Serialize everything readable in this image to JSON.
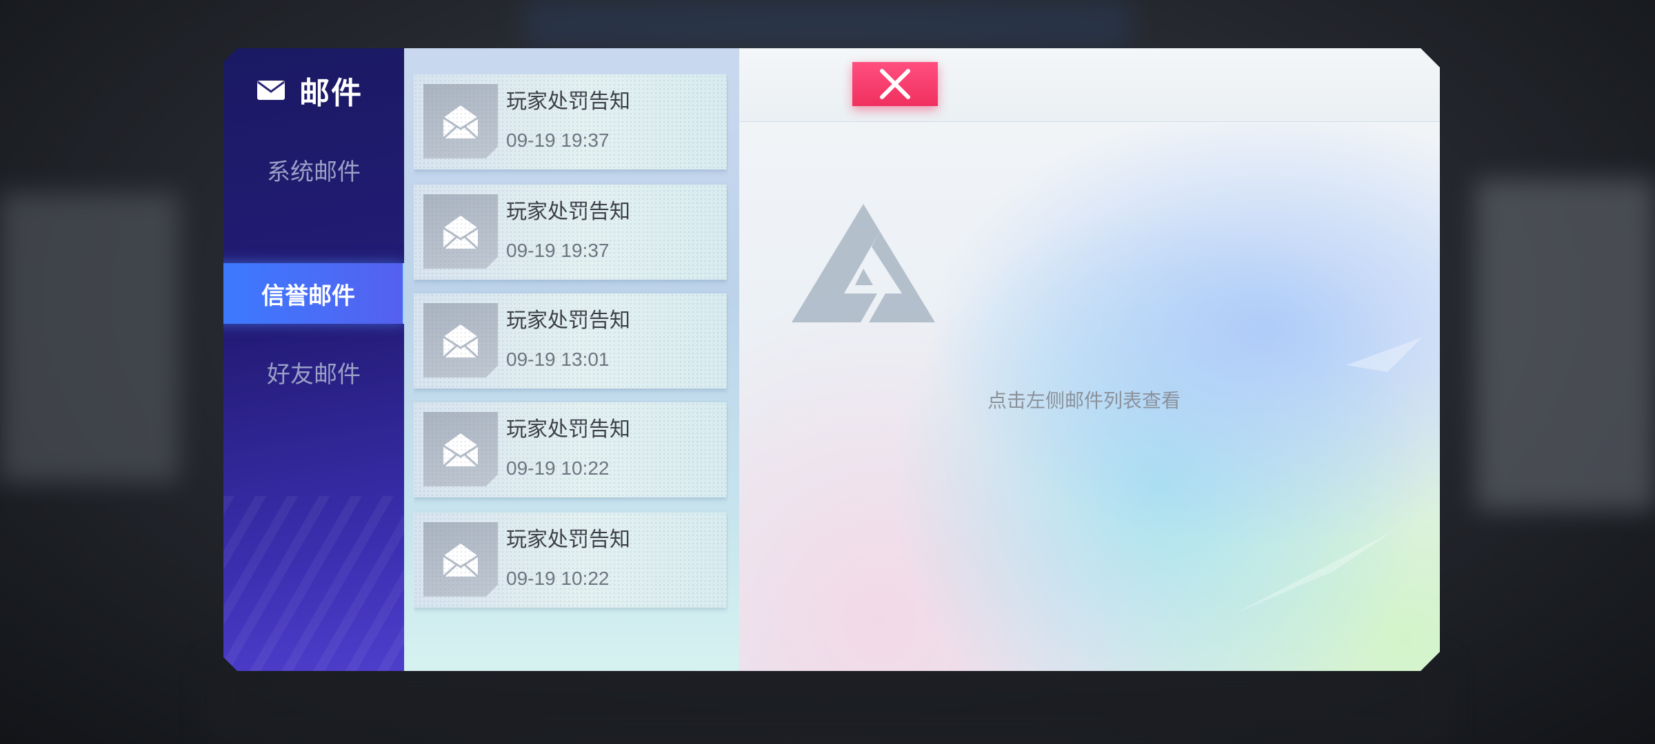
{
  "header": {
    "title": "邮件",
    "title_icon": "envelope-icon"
  },
  "sidebar": {
    "items": [
      {
        "label": "系统邮件",
        "active": false
      },
      {
        "label": "信誉邮件",
        "active": true
      },
      {
        "label": "好友邮件",
        "active": false
      }
    ]
  },
  "mail_list": [
    {
      "title": "玩家处罚告知",
      "time": "09-19 19:37"
    },
    {
      "title": "玩家处罚告知",
      "time": "09-19 19:37"
    },
    {
      "title": "玩家处罚告知",
      "time": "09-19 13:01"
    },
    {
      "title": "玩家处罚告知",
      "time": "09-19 10:22"
    },
    {
      "title": "玩家处罚告知",
      "time": "09-19 10:22"
    }
  ],
  "detail": {
    "empty_hint": "点击左侧邮件列表查看",
    "close_icon": "close-icon"
  },
  "colors": {
    "accent": "#3b7bff",
    "close": "#f0305f",
    "sidebar": "#241c78"
  }
}
